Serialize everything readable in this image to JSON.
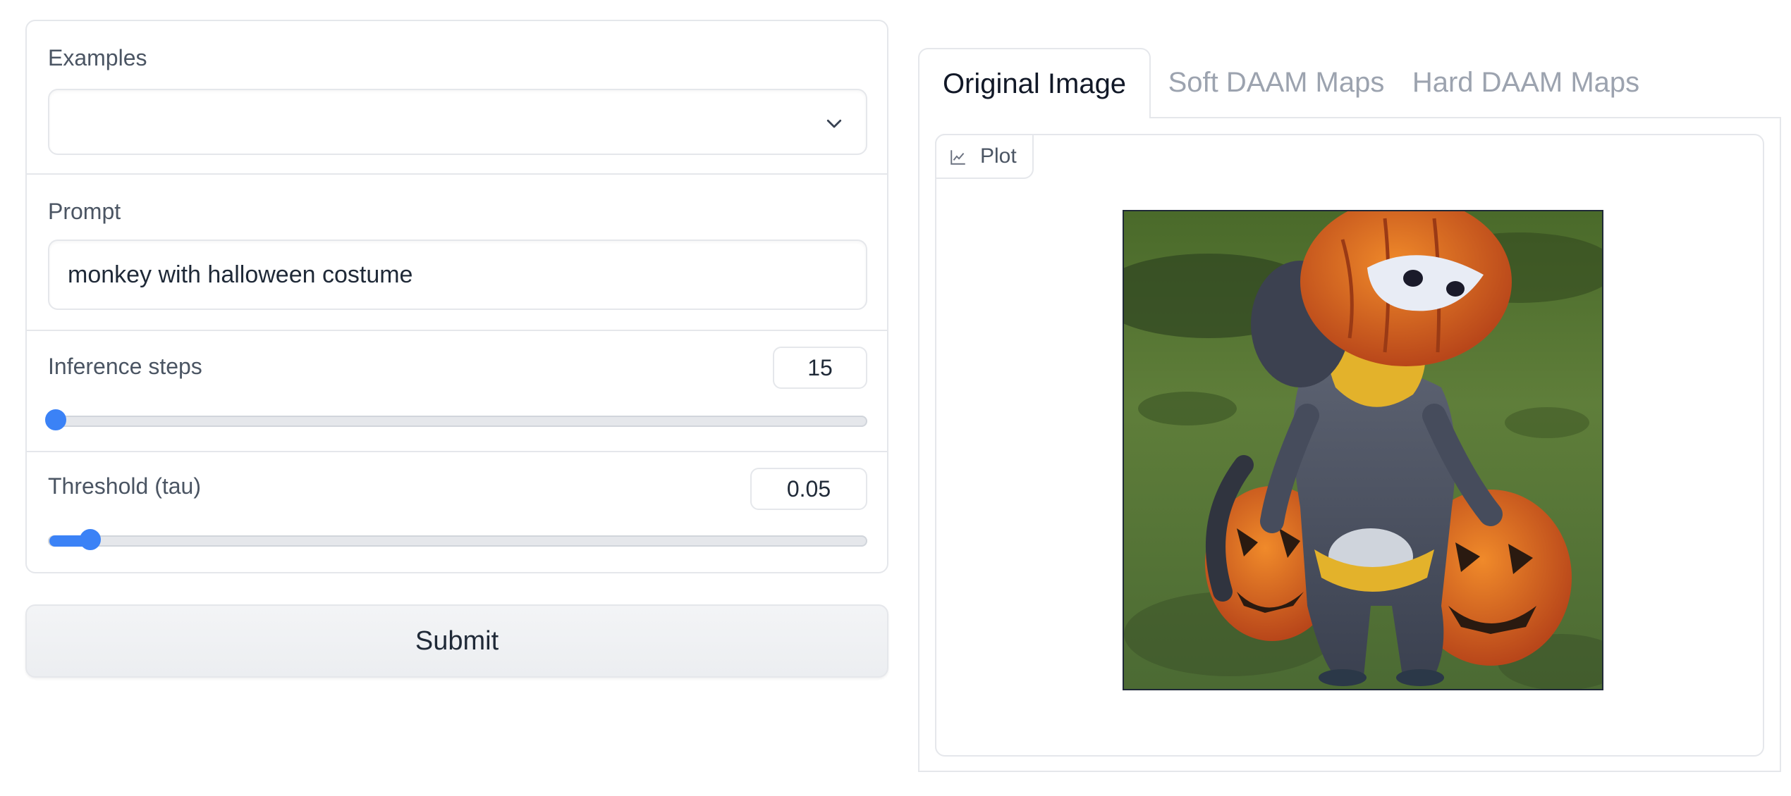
{
  "left": {
    "examples": {
      "label": "Examples",
      "value": ""
    },
    "prompt": {
      "label": "Prompt",
      "value": "monkey with halloween costume"
    },
    "inference_steps": {
      "label": "Inference steps",
      "value": "15",
      "slider_fraction": 0.0
    },
    "threshold": {
      "label": "Threshold (tau)",
      "value": "0.05",
      "slider_fraction": 0.05
    },
    "submit_label": "Submit"
  },
  "right": {
    "tabs": [
      {
        "label": "Original Image",
        "active": true
      },
      {
        "label": "Soft DAAM Maps",
        "active": false
      },
      {
        "label": "Hard DAAM Maps",
        "active": false
      }
    ],
    "plot_label": "Plot",
    "image_alt": "monkey in halloween pumpkin costume standing between two jack-o-lanterns on grass"
  },
  "colors": {
    "accent": "#3b82f6",
    "border": "#e5e7eb"
  },
  "icons": {
    "dropdown": "chevron-down-icon",
    "plot": "chart-icon"
  }
}
